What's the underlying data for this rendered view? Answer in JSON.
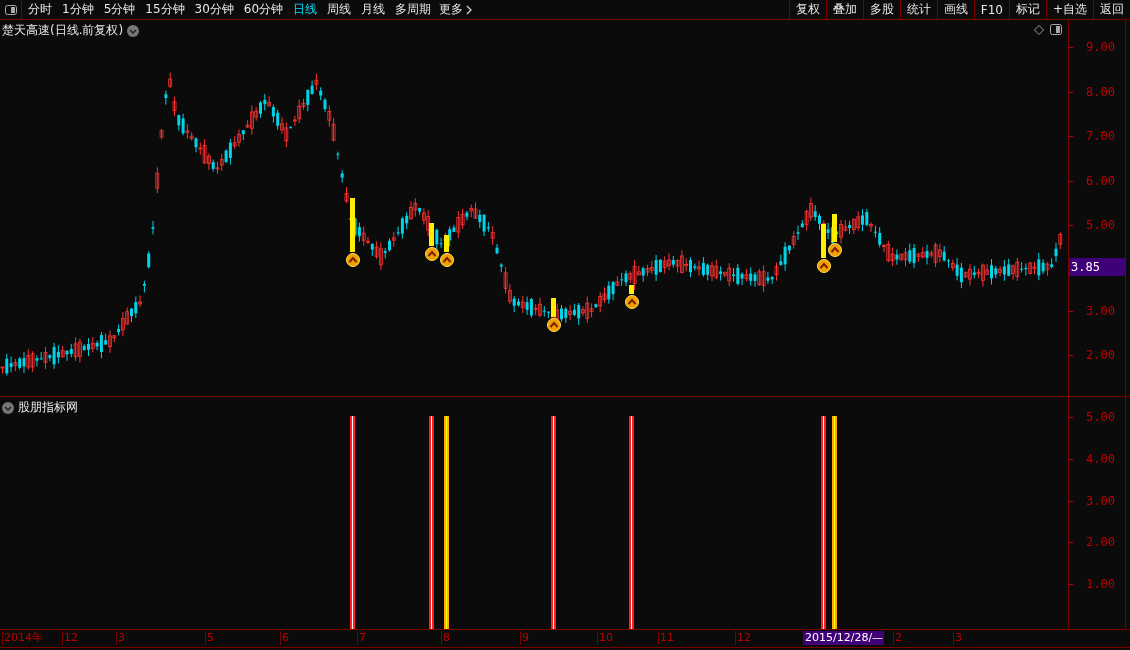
{
  "toolbar": {
    "periods": [
      {
        "label": "分时",
        "selected": false
      },
      {
        "label": "1分钟",
        "selected": false
      },
      {
        "label": "5分钟",
        "selected": false
      },
      {
        "label": "15分钟",
        "selected": false
      },
      {
        "label": "30分钟",
        "selected": false
      },
      {
        "label": "60分钟",
        "selected": false
      },
      {
        "label": "日线",
        "selected": true
      },
      {
        "label": "周线",
        "selected": false
      },
      {
        "label": "月线",
        "selected": false
      },
      {
        "label": "多周期",
        "selected": false
      }
    ],
    "more": "更多",
    "buttons": [
      "复权",
      "叠加",
      "多股",
      "统计",
      "画线",
      "F10",
      "标记",
      "+自选",
      "返回"
    ]
  },
  "main_chart": {
    "title": "楚天高速(日线.前复权)",
    "y_labels": [
      "9.00",
      "8.00",
      "7.00",
      "6.00",
      "5.00",
      "3.00",
      "2.00"
    ],
    "last_price": "3.85"
  },
  "indicator": {
    "title": "股朋指标网",
    "y_labels": [
      "5.00",
      "4.00",
      "3.00",
      "2.00",
      "1.00"
    ]
  },
  "date_axis": [
    {
      "label": "2014年",
      "highlighted": false
    },
    {
      "label": "12",
      "highlighted": false
    },
    {
      "label": "3",
      "highlighted": false
    },
    {
      "label": "5",
      "highlighted": false
    },
    {
      "label": "6",
      "highlighted": false
    },
    {
      "label": "7",
      "highlighted": false
    },
    {
      "label": "8",
      "highlighted": false
    },
    {
      "label": "9",
      "highlighted": false
    },
    {
      "label": "10",
      "highlighted": false
    },
    {
      "label": "11",
      "highlighted": false
    },
    {
      "label": "12",
      "highlighted": false
    },
    {
      "label": "2015/12/28/—",
      "highlighted": true
    },
    {
      "label": "2",
      "highlighted": false
    },
    {
      "label": "3",
      "highlighted": false
    }
  ]
}
